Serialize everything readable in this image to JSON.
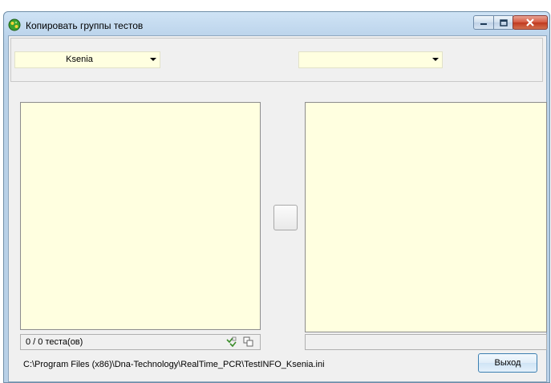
{
  "window": {
    "title": "Копировать группы тестов",
    "icon": "app-green-icon"
  },
  "caption_buttons": {
    "minimize": "minimize-icon",
    "maximize": "maximize-icon",
    "close": "close-icon"
  },
  "source": {
    "selected": "Ksenia"
  },
  "target": {
    "selected": ""
  },
  "status": {
    "count_text": "0 / 0 теста(ов)"
  },
  "footer": {
    "path": "C:\\Program Files (x86)\\Dna-Technology\\RealTime_PCR\\TestINFO_Ksenia.ini",
    "exit_label": "Выход"
  },
  "colors": {
    "list_bg": "#ffffe0",
    "panel_bg": "#f0f0f0",
    "close_btn": "#c94a35"
  }
}
